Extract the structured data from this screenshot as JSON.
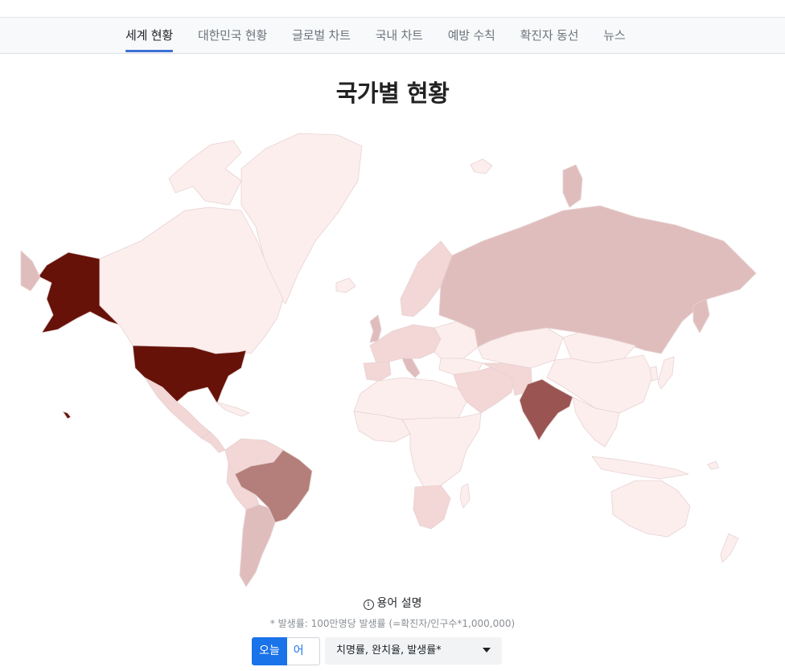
{
  "nav": {
    "tabs": [
      {
        "label": "세계 현황",
        "active": true
      },
      {
        "label": "대한민국 현황",
        "active": false
      },
      {
        "label": "글로벌 차트",
        "active": false
      },
      {
        "label": "국내 차트",
        "active": false
      },
      {
        "label": "예방 수칙",
        "active": false
      },
      {
        "label": "확진자 동선",
        "active": false
      },
      {
        "label": "뉴스",
        "active": false
      }
    ]
  },
  "page": {
    "title": "국가별 현황"
  },
  "map": {
    "colors": {
      "none": "#ffffff",
      "level1": "#fdeeee",
      "level2": "#f3d6d6",
      "level3": "#e0bdbd",
      "level4": "#b47f7a",
      "level5": "#9a5552",
      "level6": "#661209",
      "border": "#e7d2d2"
    }
  },
  "glossary": {
    "icon": "info-circle-icon",
    "label": "용어 설명",
    "footnote": "* 발생률: 100만명당 발생률 (=확진자/인구수*1,000,000)"
  },
  "controls": {
    "today_label": "오늘",
    "yesterday_label": "어제",
    "selected_metric": "치명률, 완치율, 발생률*",
    "accent": "#1a73e8"
  }
}
